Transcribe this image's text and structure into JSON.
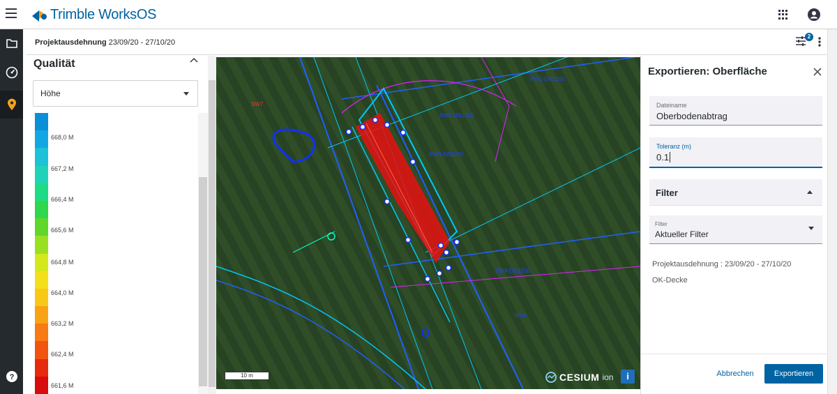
{
  "app": {
    "name": "Trimble WorksOS",
    "brand_color": "#0063a3"
  },
  "header": {
    "project_label": "Projektausdehnung",
    "project_dates": "23/09/20 - 27/10/20",
    "filter_badge": "2"
  },
  "sidebar": {
    "items": [
      {
        "icon": "folder-icon",
        "active": false
      },
      {
        "icon": "dashboard-gauge-icon",
        "active": false
      },
      {
        "icon": "map-pin-icon",
        "active": true
      },
      {
        "icon": "help-icon",
        "active": false
      }
    ]
  },
  "legend": {
    "title": "Qualität",
    "dropdown_value": "Höhe",
    "scale_labels": [
      "668,0 M",
      "667,2 M",
      "666,4 M",
      "665,6 M",
      "664,8 M",
      "664,0 M",
      "663,2 M",
      "662,4 M",
      "661,6 M"
    ],
    "gradient_colors": [
      "#0a8fd8",
      "#12a7e4",
      "#1cc2d6",
      "#20d3b8",
      "#1edb86",
      "#2ed84c",
      "#5fd82a",
      "#9ae022",
      "#d4e81c",
      "#f4e01a",
      "#f9c816",
      "#f9a214",
      "#f77a12",
      "#f25410",
      "#e62a0e",
      "#d80c0c"
    ]
  },
  "map": {
    "scale_label": "10 m",
    "attribution": "CESIUM",
    "attribution_suffix": "ion",
    "info_button": "i",
    "annotations": [
      "SW7",
      "RW2-DN1200",
      "RW3-DN1200",
      "RW1-DN1200",
      "RW4-DN1200",
      "RW5"
    ]
  },
  "export": {
    "title": "Exportieren: Oberfläche",
    "filename_label": "Dateiname",
    "filename_value": "Oberbodenabtrag",
    "tolerance_label": "Toleranz (m)",
    "tolerance_value": "0.1",
    "filter_section": "Filter",
    "filter_label": "Filter",
    "filter_value": "Aktueller Filter",
    "info_project": "Projektausdehnung : 23/09/20 - 27/10/20",
    "info_layer": "OK-Decke",
    "cancel_label": "Abbrechen",
    "export_label": "Exportieren"
  }
}
